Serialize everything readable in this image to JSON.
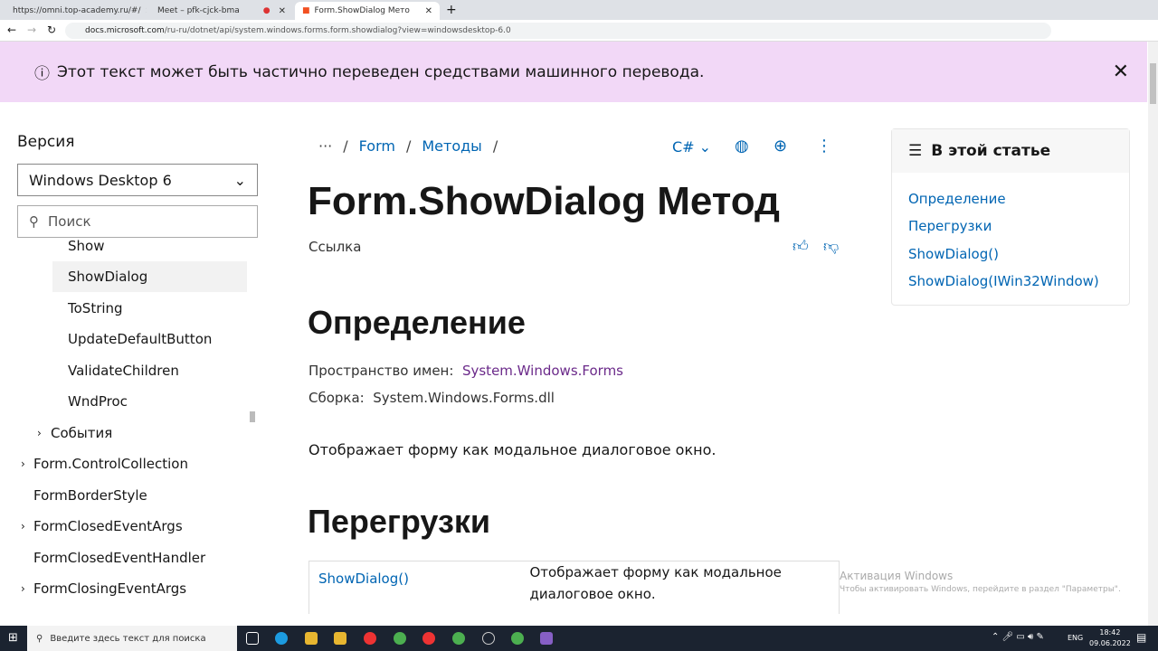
{
  "browser": {
    "tabs": [
      {
        "title": "https://omni.top-academy.ru/#/"
      },
      {
        "title": "Meet – pfk-cjck-bma"
      },
      {
        "title": "Form.ShowDialog Метод (System"
      }
    ],
    "url_host": "docs.microsoft.com",
    "url_path": "/ru-ru/dotnet/api/system.windows.forms.form.showdialog?view=windowsdesktop-6.0"
  },
  "banner": {
    "text": "Этот текст может быть частично переведен средствами машинного перевода."
  },
  "sidebar": {
    "version_label": "Версия",
    "version_value": "Windows Desktop 6",
    "search_placeholder": "Поиск",
    "items": [
      {
        "label": "Show"
      },
      {
        "label": "ShowDialog"
      },
      {
        "label": "ToString"
      },
      {
        "label": "UpdateDefaultButton"
      },
      {
        "label": "ValidateChildren"
      },
      {
        "label": "WndProc"
      },
      {
        "label": "События"
      },
      {
        "label": "Form.ControlCollection"
      },
      {
        "label": "FormBorderStyle"
      },
      {
        "label": "FormClosedEventArgs"
      },
      {
        "label": "FormClosedEventHandler"
      },
      {
        "label": "FormClosingEventArgs"
      }
    ]
  },
  "breadcrumb": {
    "ellipsis": "···",
    "items": [
      "Form",
      "Методы"
    ],
    "language": "C#"
  },
  "article": {
    "title": "Form.ShowDialog Метод",
    "subtitle": "Ссылка",
    "h_definition": "Определение",
    "namespace_label": "Пространство имен:",
    "namespace_value": "System.Windows.Forms",
    "assembly_label": "Сборка:",
    "assembly_value": "System.Windows.Forms.dll",
    "summary": "Отображает форму как модальное диалоговое окно.",
    "h_overloads": "Перегрузки",
    "overloads": [
      {
        "name": "ShowDialog()",
        "desc": "Отображает форму как модальное диалоговое окно."
      }
    ]
  },
  "toc": {
    "title": "В этой статье",
    "items": [
      "Определение",
      "Перегрузки",
      "ShowDialog()",
      "ShowDialog(IWin32Window)"
    ]
  },
  "watermark": {
    "title": "Активация Windows",
    "text": "Чтобы активировать Windows, перейдите в раздел \"Параметры\"."
  },
  "taskbar": {
    "search_placeholder": "Введите здесь текст для поиска",
    "lang": "ENG",
    "time": "18:42",
    "date": "09.06.2022"
  }
}
